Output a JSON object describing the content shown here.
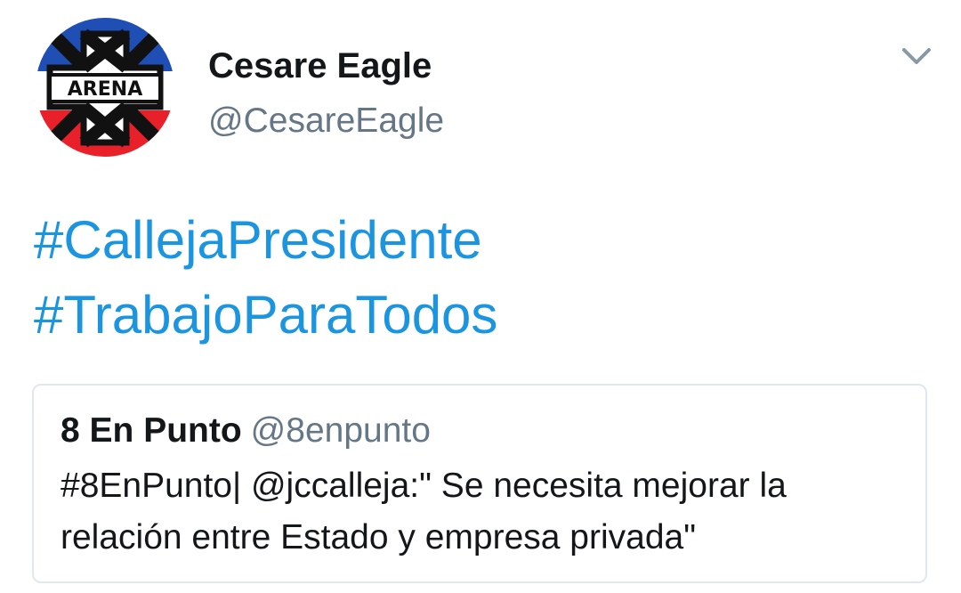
{
  "tweet": {
    "author": {
      "display_name": "Cesare Eagle",
      "handle": "@CesareEagle",
      "avatar_icon": "arena-party-logo-icon",
      "avatar_text": "ARENA"
    },
    "menu_icon": "chevron-down-icon",
    "hashtags": [
      "#CallejaPresidente",
      "#TrabajoParaTodos"
    ],
    "quoted": {
      "display_name": "8 En Punto",
      "handle": "@8enpunto",
      "text_line_1": "#8EnPunto| @jccalleja:\" Se necesita mejorar la",
      "text_line_2": "relación entre Estado y empresa privada\""
    }
  },
  "colors": {
    "link": "#1b95e0",
    "secondary_text": "#657786",
    "primary_text": "#14171a",
    "card_border": "#e1e8ed",
    "avatar_blue": "#1f4fb4",
    "avatar_red": "#e8202a"
  }
}
